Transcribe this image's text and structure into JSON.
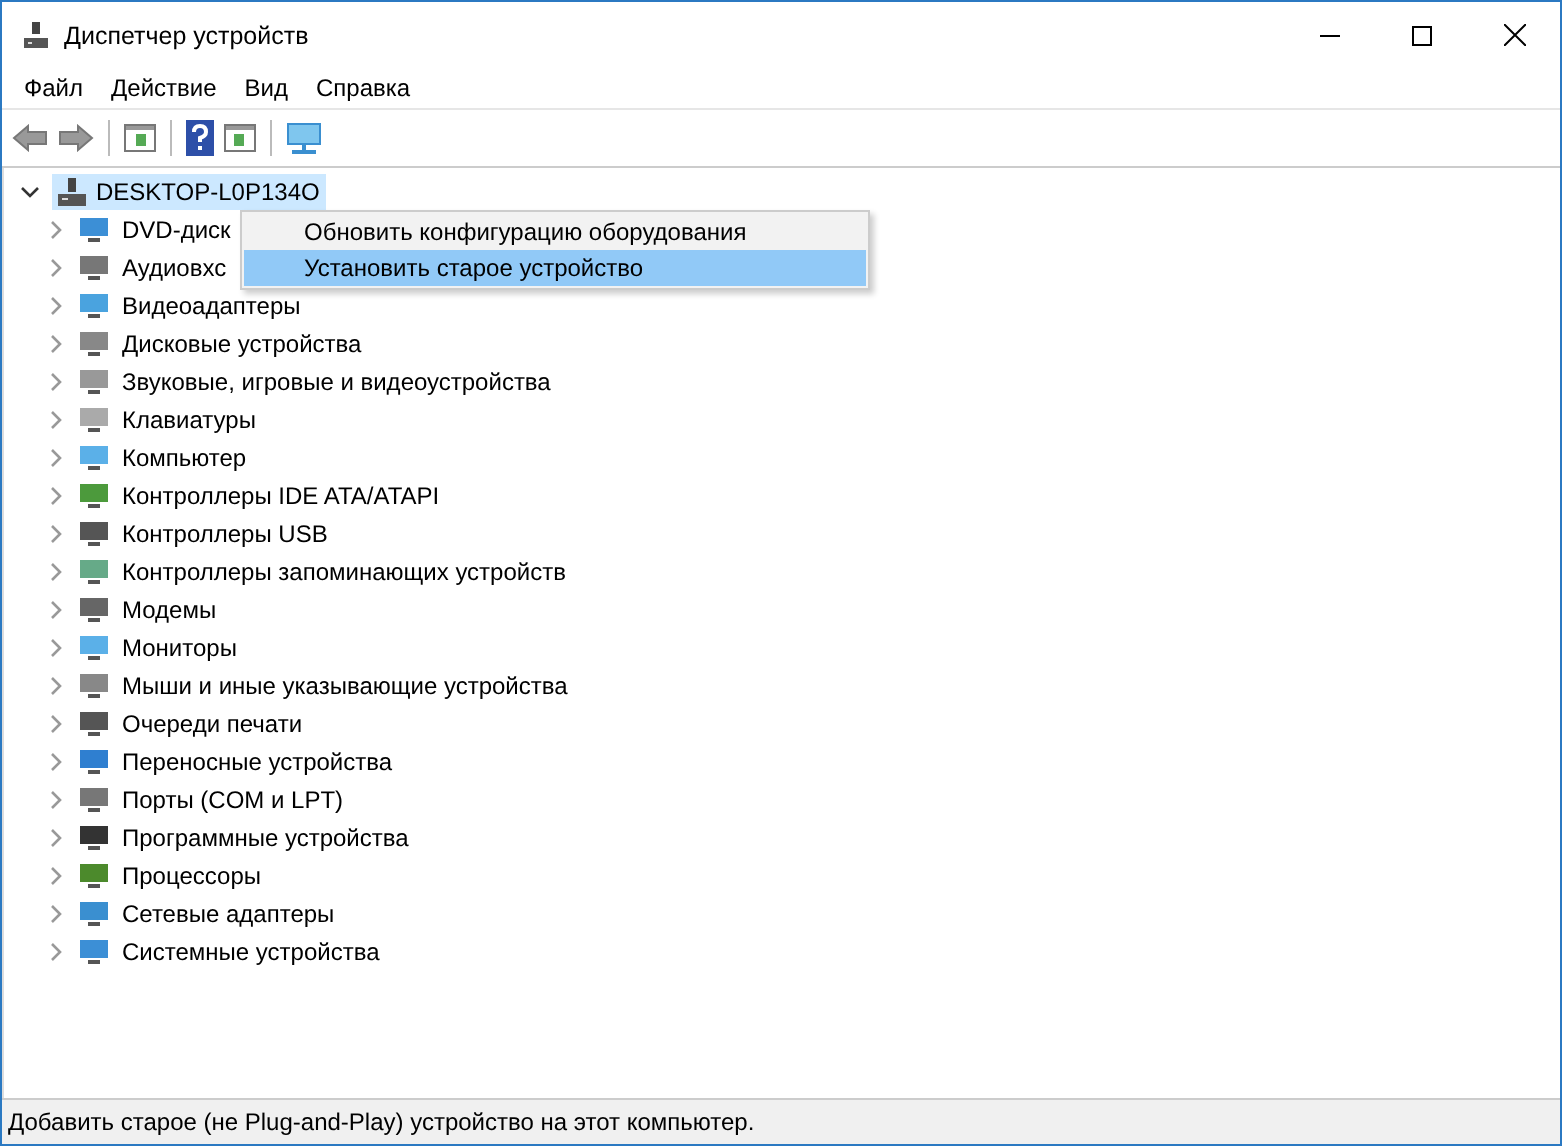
{
  "window": {
    "title": "Диспетчер устройств"
  },
  "menu_bar": [
    "Файл",
    "Действие",
    "Вид",
    "Справка"
  ],
  "tree": {
    "label": "DESKTOP-L0P134O",
    "expanded": true,
    "selected": true,
    "children": [
      {
        "label": "DVD-диск",
        "expanded": false
      },
      {
        "label": "Аудиовхс",
        "expanded": false
      },
      {
        "label": "Видеоадаптеры",
        "expanded": false
      },
      {
        "label": "Дисковые устройства",
        "expanded": false
      },
      {
        "label": "Звуковые, игровые и видеоустройства",
        "expanded": false
      },
      {
        "label": "Клавиатуры",
        "expanded": false
      },
      {
        "label": "Компьютер",
        "expanded": false
      },
      {
        "label": "Контроллеры IDE ATA/ATAPI",
        "expanded": false
      },
      {
        "label": "Контроллеры USB",
        "expanded": false
      },
      {
        "label": "Контроллеры запоминающих устройств",
        "expanded": false
      },
      {
        "label": "Модемы",
        "expanded": false
      },
      {
        "label": "Мониторы",
        "expanded": false
      },
      {
        "label": "Мыши и иные указывающие устройства",
        "expanded": false
      },
      {
        "label": "Очереди печати",
        "expanded": false
      },
      {
        "label": "Переносные устройства",
        "expanded": false
      },
      {
        "label": "Порты (COM и LPT)",
        "expanded": false
      },
      {
        "label": "Программные устройства",
        "expanded": false
      },
      {
        "label": "Процессоры",
        "expanded": false
      },
      {
        "label": "Сетевые адаптеры",
        "expanded": false
      },
      {
        "label": "Системные устройства",
        "expanded": false
      }
    ]
  },
  "context_menu": [
    {
      "label": "Обновить конфигурацию оборудования",
      "selected": false
    },
    {
      "label": "Установить старое устройство",
      "selected": true
    }
  ],
  "status_bar": "Добавить старое (не Plug-and-Play) устройство на этот компьютер."
}
